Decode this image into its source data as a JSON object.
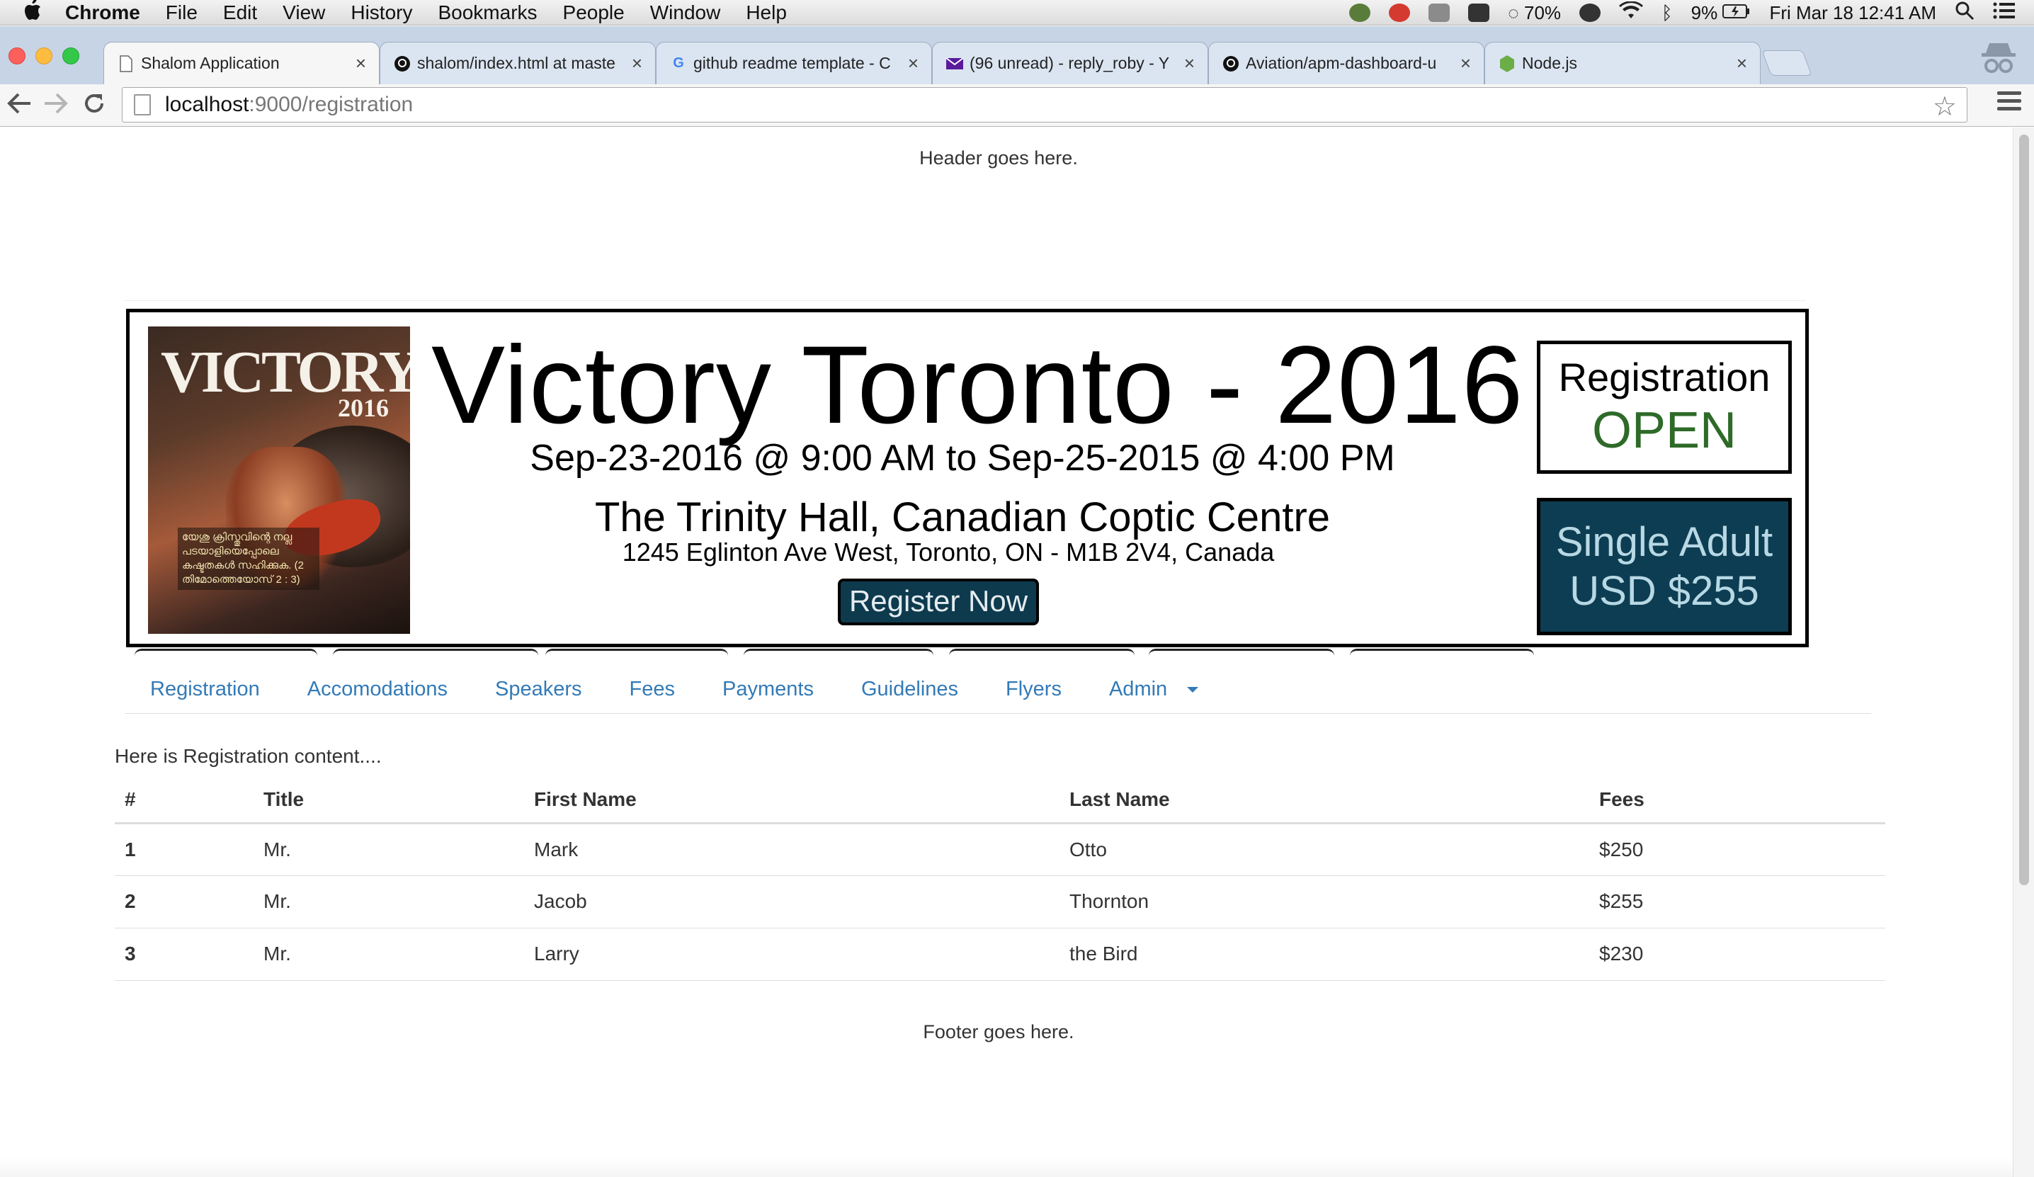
{
  "menubar": {
    "app": "Chrome",
    "items": [
      "File",
      "Edit",
      "View",
      "History",
      "Bookmarks",
      "People",
      "Window",
      "Help"
    ],
    "wifi_battery_status": "70%",
    "battery": "9%",
    "clock": "Fri Mar 18  12:41 AM"
  },
  "tabs": [
    {
      "title": "Shalom Application",
      "active": true,
      "icon": "page-icon"
    },
    {
      "title": "shalom/index.html at maste",
      "active": false,
      "icon": "github-icon"
    },
    {
      "title": "github readme template - C",
      "active": false,
      "icon": "google-icon"
    },
    {
      "title": "(96 unread) - reply_roby - Y",
      "active": false,
      "icon": "mail-icon"
    },
    {
      "title": "Aviation/apm-dashboard-u",
      "active": false,
      "icon": "github-icon"
    },
    {
      "title": "Node.js",
      "active": false,
      "icon": "nodejs-icon"
    }
  ],
  "address": {
    "host": "localhost",
    "path": ":9000/registration"
  },
  "page": {
    "header": "Header goes here.",
    "footer": "Footer goes here.",
    "content_intro": "Here is Registration content...."
  },
  "banner": {
    "poster_title": "VICTORY",
    "poster_year": "2016",
    "poster_caption": "യേശു ക്രിസ്തുവിന്റെ നല്ല പടയാളിയെപ്പോലെ കഷ്ടതകൾ സഹിക്കുക. (2 തിമോത്തെയോസ് 2 : 3)",
    "title": "Victory Toronto - 2016",
    "dates": "Sep-23-2016 @ 9:00 AM to Sep-25-2015 @ 4:00 PM",
    "venue": "The Trinity Hall, Canadian Coptic Centre",
    "address": "1245 Eglinton Ave West, Toronto, ON - M1B 2V4, Canada",
    "register_button": "Register Now",
    "registration_label": "Registration",
    "registration_status": "OPEN",
    "price_label": "Single Adult",
    "price_value": "USD $255",
    "colors": {
      "status_green": "#2e6a28",
      "price_bg": "#0d3d52",
      "button_bg": "#0e3a4e"
    }
  },
  "nav": {
    "items": [
      "Registration",
      "Accomodations",
      "Speakers",
      "Fees",
      "Payments",
      "Guidelines",
      "Flyers",
      "Admin"
    ],
    "link_color": "#337ab7"
  },
  "table": {
    "headers": [
      "#",
      "Title",
      "First Name",
      "Last Name",
      "Fees"
    ],
    "rows": [
      [
        "1",
        "Mr.",
        "Mark",
        "Otto",
        "$250"
      ],
      [
        "2",
        "Mr.",
        "Jacob",
        "Thornton",
        "$255"
      ],
      [
        "3",
        "Mr.",
        "Larry",
        "the Bird",
        "$230"
      ]
    ]
  }
}
